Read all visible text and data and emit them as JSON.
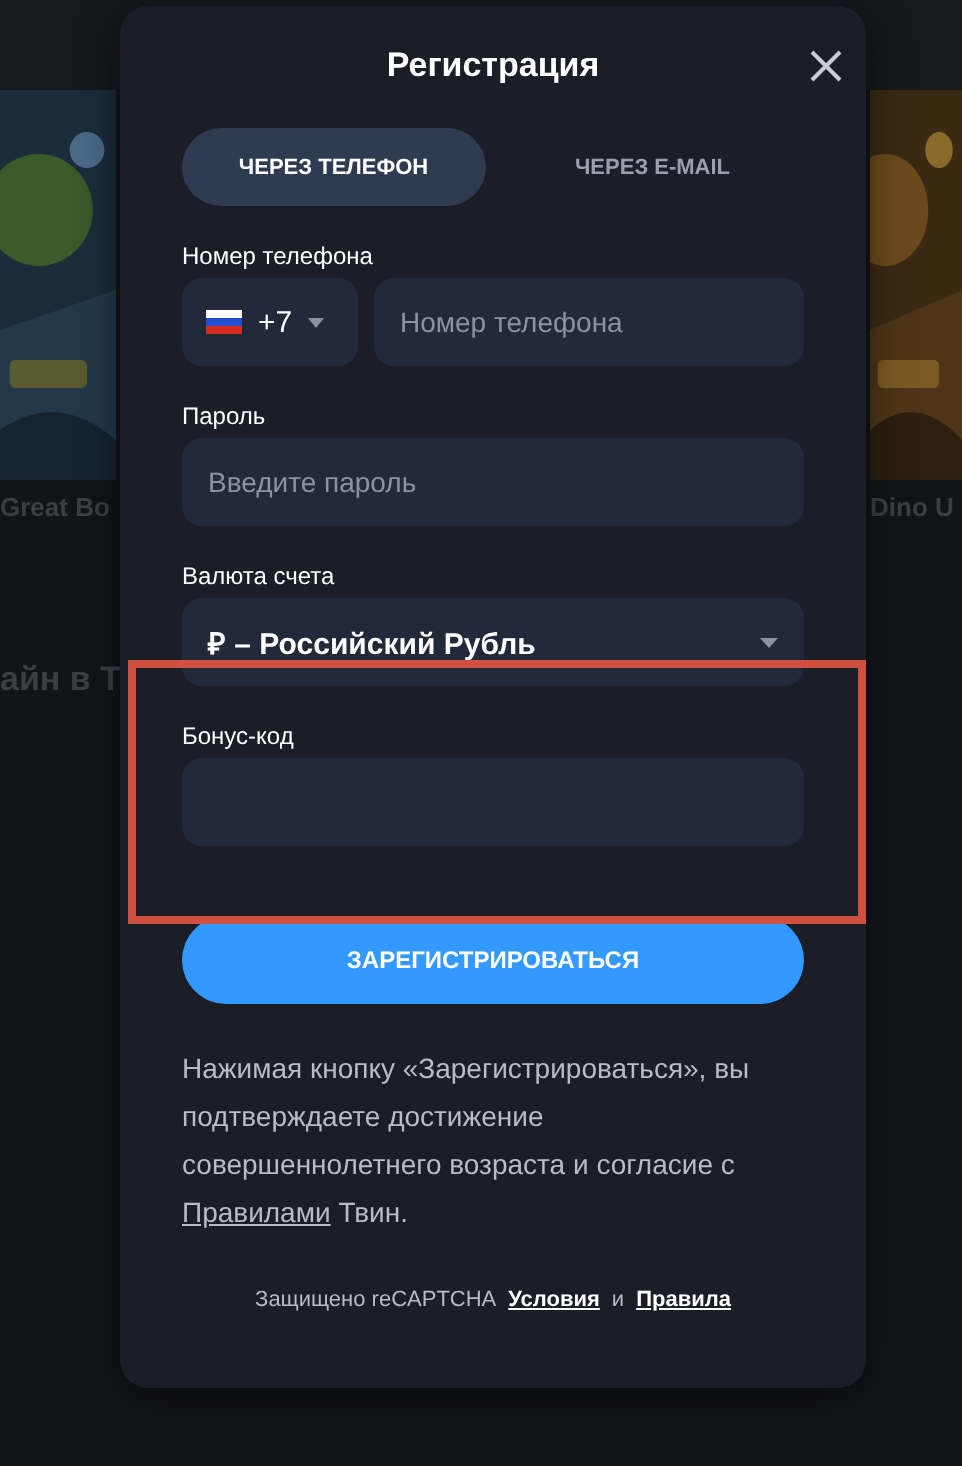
{
  "background": {
    "tiles": [
      {
        "kind": "picture",
        "caption": "Great Bo"
      },
      {
        "kind": "picture",
        "caption": "Dino U"
      }
    ],
    "heading": "айн в Т"
  },
  "dialog": {
    "title": "Регистрация",
    "tabs": [
      {
        "label": "ЧЕРЕЗ ТЕЛЕФОН",
        "selected": true
      },
      {
        "label": "ЧЕРЕЗ E-MAIL",
        "selected": false
      }
    ],
    "phone": {
      "label": "Номер телефона",
      "country_code": "+7",
      "placeholder": "Номер телефона"
    },
    "password": {
      "label": "Пароль",
      "placeholder": "Введите пароль"
    },
    "currency": {
      "label": "Валюта счета",
      "value": "₽ – Российский Рубль"
    },
    "bonus_code": {
      "label": "Бонус-код"
    },
    "submit": "ЗАРЕГИСТРИРОВАТЬСЯ",
    "terms": {
      "text": "Нажимая кнопку «Зарегистрироваться», вы подтверждаете достижение совершеннолетнего возраста и согласие с",
      "link": "Правилами",
      "after": "Твин."
    },
    "recaptcha": {
      "text": "Защищено reCAPTCHA",
      "terms_link": "Условия",
      "and": "и",
      "rules_link": "Правила"
    }
  },
  "highlight": {
    "color": "#d0503f"
  }
}
